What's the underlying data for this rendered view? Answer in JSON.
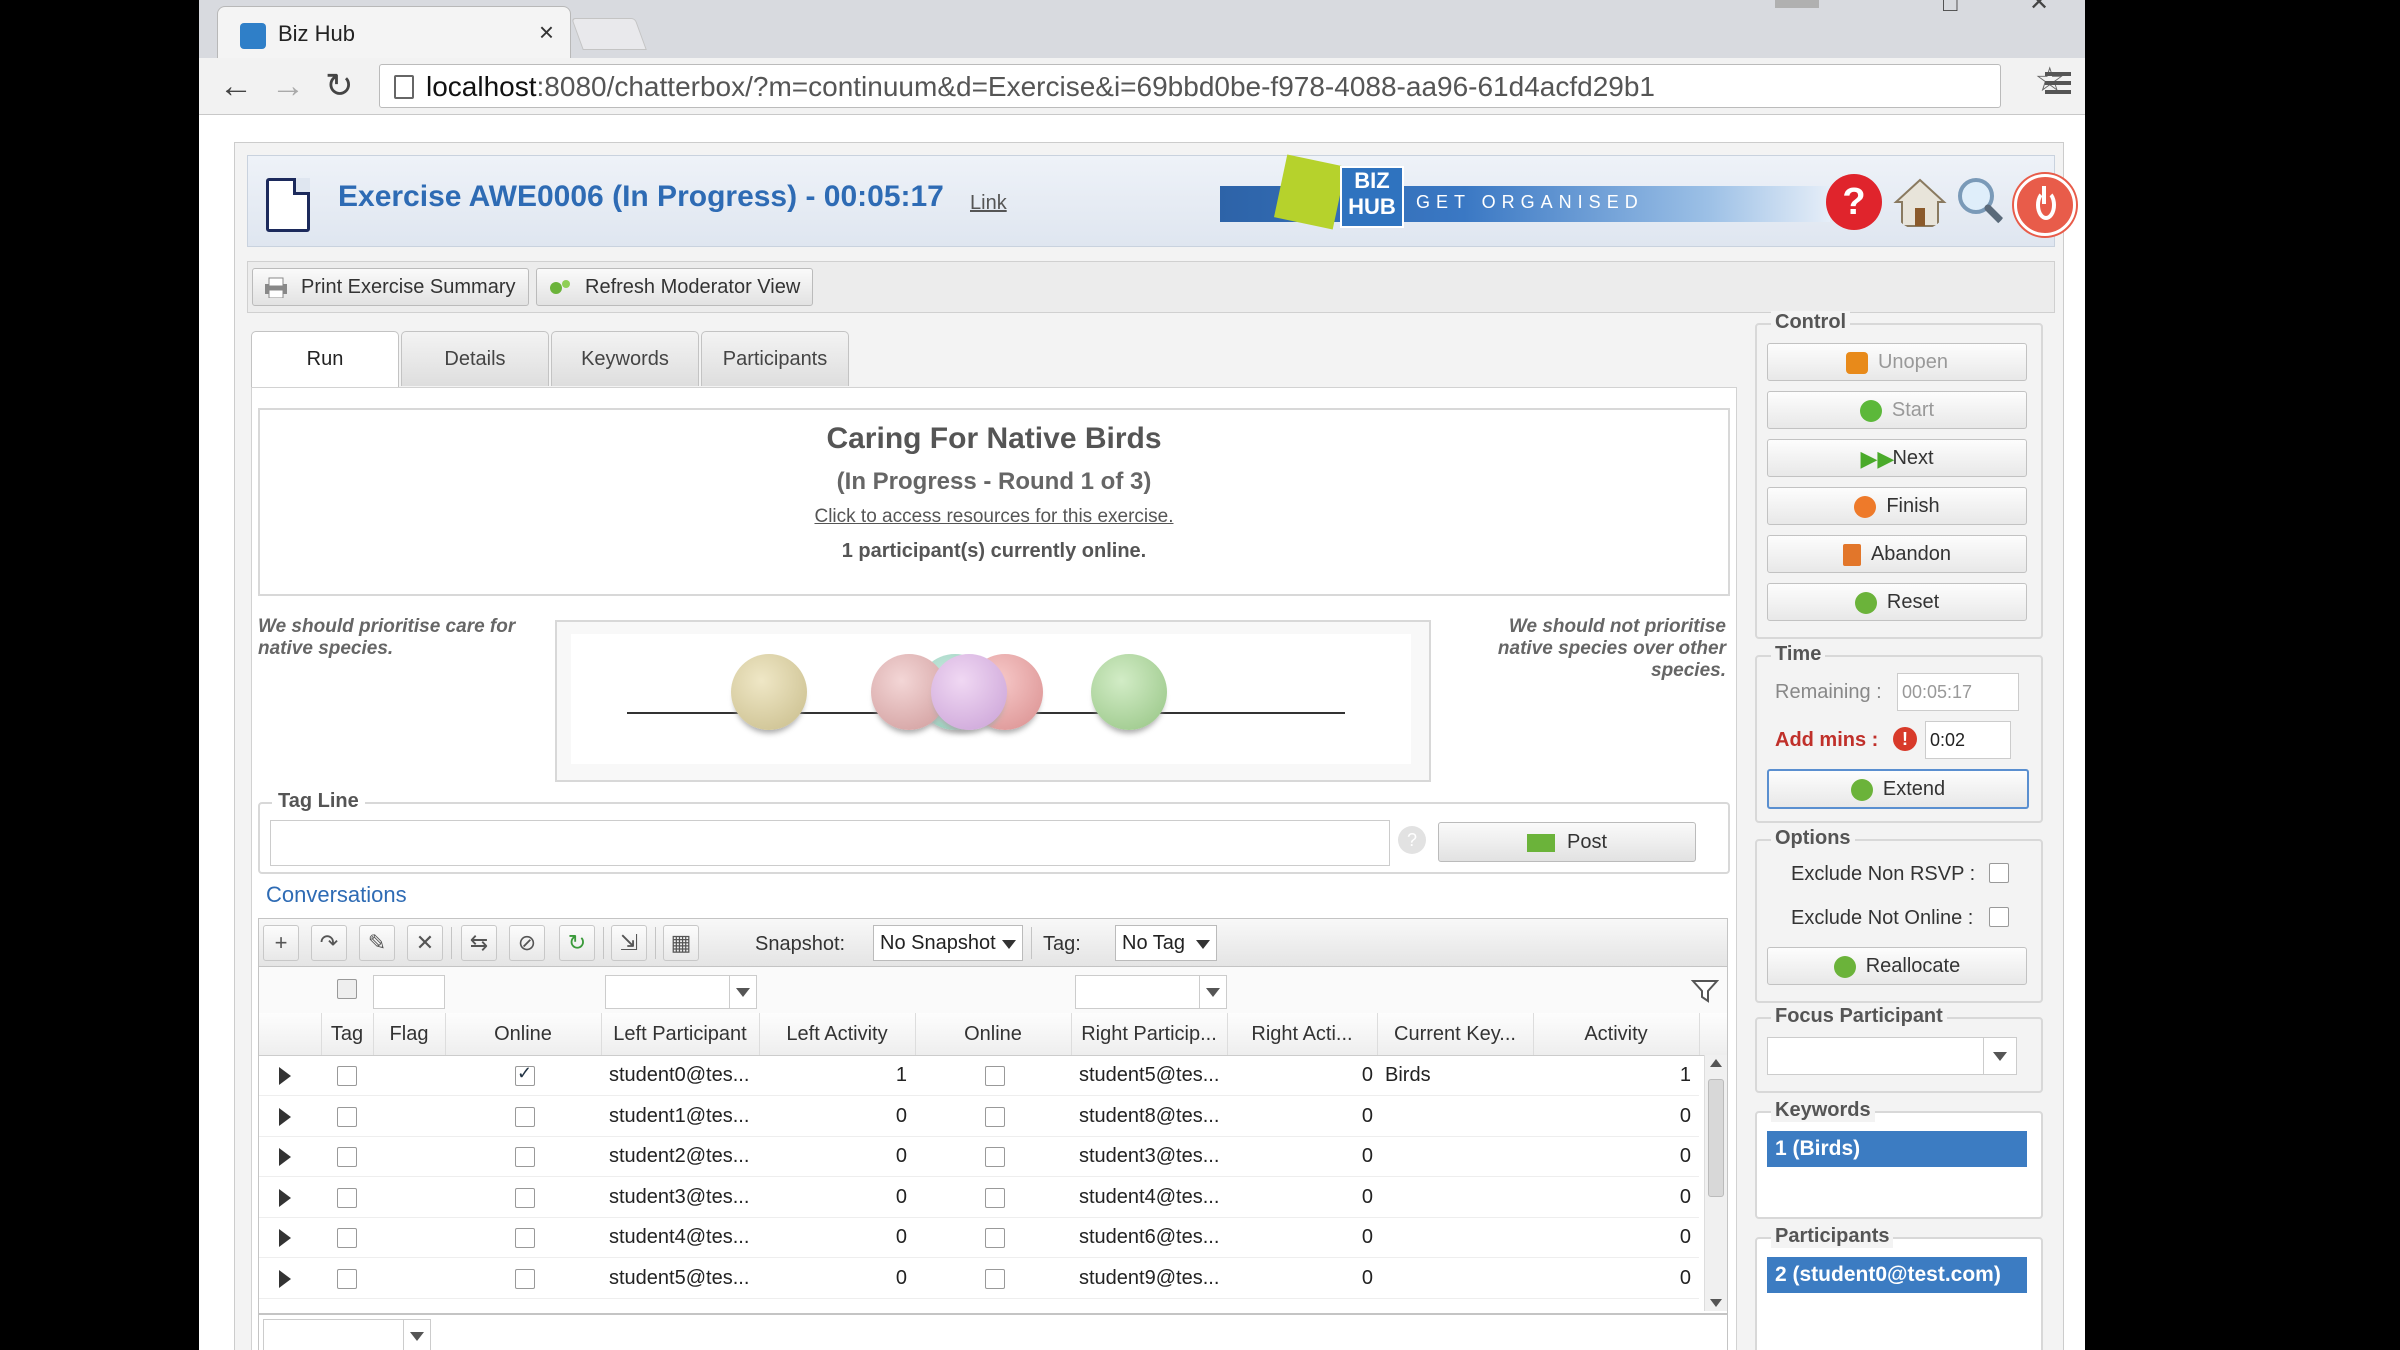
{
  "browser": {
    "tab_title": "Biz Hub",
    "url_host": "localhost",
    "url_rest": ":8080/chatterbox/?m=continuum&d=Exercise&i=69bbd0be-f978-4088-aa96-61d4acfd29b1"
  },
  "header": {
    "title": "Exercise AWE0006 (In Progress) - 00:05:17",
    "link": "Link",
    "logo_text": "BIZ HUB",
    "tagline": "GET ORGANISED"
  },
  "toolbar": {
    "print_label": "Print Exercise Summary",
    "refresh_label": "Refresh Moderator View"
  },
  "tabs": [
    "Run",
    "Details",
    "Keywords",
    "Participants"
  ],
  "exercise": {
    "name": "Caring For Native Birds",
    "status": "(In Progress - Round 1 of 3)",
    "resources_link": "Click to access resources for this exercise.",
    "online": "1 participant(s) currently online.",
    "left_statement": "We should prioritise care for native species.",
    "right_statement": "We should not prioritise native species over other species."
  },
  "tagline": {
    "legend": "Tag Line",
    "value": "",
    "post_label": "Post"
  },
  "conversations": {
    "title": "Conversations",
    "snapshot_label": "Snapshot:",
    "snapshot_value": "No Snapshot",
    "tag_label": "Tag:",
    "tag_value": "No Tag",
    "columns": [
      "Tag",
      "Flag",
      "Online",
      "Left Participant",
      "Left Activity",
      "Online",
      "Right Particip...",
      "Right Acti...",
      "Current Key...",
      "Activity"
    ],
    "rows": [
      {
        "left_online": true,
        "left": "student0@tes...",
        "left_activity": "1",
        "right_online": false,
        "right": "student5@tes...",
        "right_activity": "0",
        "keyword": "Birds",
        "activity": "1"
      },
      {
        "left_online": false,
        "left": "student1@tes...",
        "left_activity": "0",
        "right_online": false,
        "right": "student8@tes...",
        "right_activity": "0",
        "keyword": "",
        "activity": "0"
      },
      {
        "left_online": false,
        "left": "student2@tes...",
        "left_activity": "0",
        "right_online": false,
        "right": "student3@tes...",
        "right_activity": "0",
        "keyword": "",
        "activity": "0"
      },
      {
        "left_online": false,
        "left": "student3@tes...",
        "left_activity": "0",
        "right_online": false,
        "right": "student4@tes...",
        "right_activity": "0",
        "keyword": "",
        "activity": "0"
      },
      {
        "left_online": false,
        "left": "student4@tes...",
        "left_activity": "0",
        "right_online": false,
        "right": "student6@tes...",
        "right_activity": "0",
        "keyword": "",
        "activity": "0"
      },
      {
        "left_online": false,
        "left": "student5@tes...",
        "left_activity": "0",
        "right_online": false,
        "right": "student9@tes...",
        "right_activity": "0",
        "keyword": "",
        "activity": "0"
      }
    ]
  },
  "control": {
    "legend": "Control",
    "unopen": "Unopen",
    "start": "Start",
    "next": "Next",
    "finish": "Finish",
    "abandon": "Abandon",
    "reset": "Reset"
  },
  "time": {
    "legend": "Time",
    "remaining_label": "Remaining :",
    "remaining_value": "00:05:17",
    "add_label": "Add mins :",
    "add_value": "0:02",
    "extend": "Extend"
  },
  "options": {
    "legend": "Options",
    "exclude_rsvp": "Exclude Non RSVP :",
    "exclude_online": "Exclude Not Online :",
    "reallocate": "Reallocate"
  },
  "focus": {
    "legend": "Focus Participant",
    "value": ""
  },
  "keywords": {
    "legend": "Keywords",
    "selected": "1 (Birds)"
  },
  "participants": {
    "legend": "Participants",
    "selected": "2 (student0@test.com)"
  },
  "colors": {
    "accent": "#2e6bb4",
    "selection": "#3c7cc2",
    "alert": "#c0302a"
  }
}
